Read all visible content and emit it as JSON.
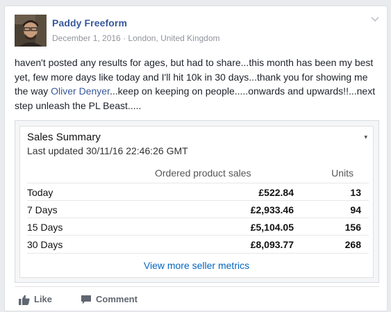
{
  "post": {
    "author": "Paddy Freeform",
    "date": "December 1, 2016",
    "separator": "·",
    "location": "London, United Kingdom",
    "text_before_link": "haven't posted any results for ages, but had to share...this month has been my best yet, few more days like today and I'll hit 10k in 30 days...thank you for showing me the way ",
    "link_text": "Oliver Denyer",
    "text_after_link": "...keep on keeping on people.....onwards and upwards!!...next step unleash the PL Beast.....",
    "icons": {
      "options": "chevron-down-icon",
      "like": "thumbs-up-icon",
      "comment": "comment-bubble-icon"
    }
  },
  "sales_summary": {
    "title": "Sales Summary",
    "updated": "Last updated 30/11/16 22:46:26 GMT",
    "caret": "▾",
    "headers": {
      "sales": "Ordered product sales",
      "units": "Units"
    },
    "rows": [
      {
        "period": "Today",
        "sales": "£522.84",
        "units": "13"
      },
      {
        "period": "7 Days",
        "sales": "£2,933.46",
        "units": "94"
      },
      {
        "period": "15 Days",
        "sales": "£5,104.05",
        "units": "156"
      },
      {
        "period": "30 Days",
        "sales": "£8,093.77",
        "units": "268"
      }
    ],
    "more_link": "View more seller metrics"
  },
  "actions": {
    "like": "Like",
    "comment": "Comment"
  },
  "colors": {
    "link": "#365899",
    "amazon_link": "#0066c0",
    "background": "#e9ebee"
  }
}
